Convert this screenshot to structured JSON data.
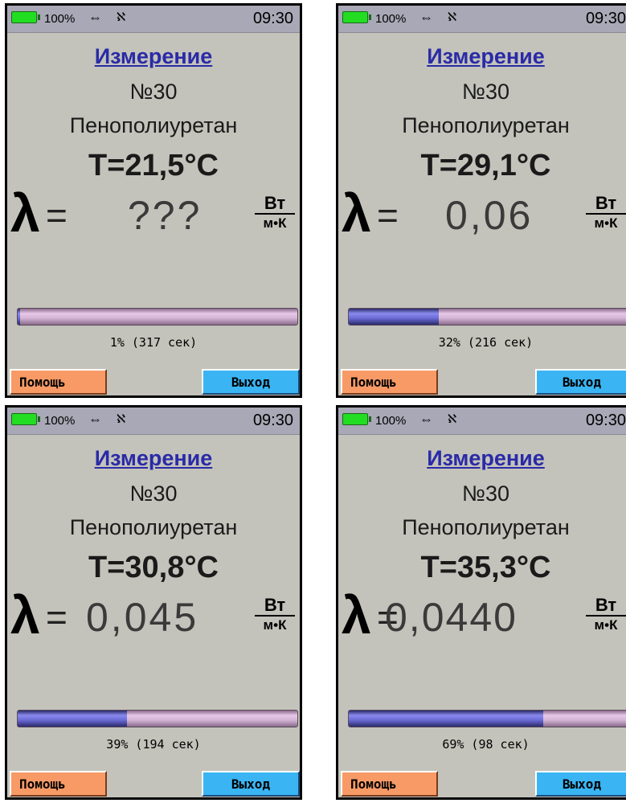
{
  "screens": [
    {
      "status": {
        "battery": "100%",
        "usb_icon": "⇔",
        "bt_icon": "ℵ",
        "time": "09:30"
      },
      "title": "Измерение",
      "number": "№30",
      "material": "Пенополиуретан",
      "temperature": "T=21,5°C",
      "lambda_symbol": "λ",
      "equals": "=",
      "lambda_value": "???",
      "unit_numerator": "Вт",
      "unit_denominator": "м•К",
      "progress_percent": 1,
      "progress_text": "1% (317 сек)",
      "help_label": "Помощь",
      "exit_label": "Выход"
    },
    {
      "status": {
        "battery": "100%",
        "usb_icon": "⇔",
        "bt_icon": "ℵ",
        "time": "09:30"
      },
      "title": "Измерение",
      "number": "№30",
      "material": "Пенополиуретан",
      "temperature": "T=29,1°C",
      "lambda_symbol": "λ",
      "equals": "=",
      "lambda_value": "0,06",
      "unit_numerator": "Вт",
      "unit_denominator": "м•К",
      "progress_percent": 32,
      "progress_text": "32% (216 сек)",
      "help_label": "Помощь",
      "exit_label": "Выход"
    },
    {
      "status": {
        "battery": "100%",
        "usb_icon": "⇔",
        "bt_icon": "ℵ",
        "time": "09:30"
      },
      "title": "Измерение",
      "number": "№30",
      "material": "Пенополиуретан",
      "temperature": "T=30,8°C",
      "lambda_symbol": "λ",
      "equals": "=",
      "lambda_value": "0,045",
      "unit_numerator": "Вт",
      "unit_denominator": "м•К",
      "progress_percent": 39,
      "progress_text": "39% (194 сек)",
      "help_label": "Помощь",
      "exit_label": "Выход"
    },
    {
      "status": {
        "battery": "100%",
        "usb_icon": "⇔",
        "bt_icon": "ℵ",
        "time": "09:30"
      },
      "title": "Измерение",
      "number": "№30",
      "material": "Пенополиуретан",
      "temperature": "T=35,3°C",
      "lambda_symbol": "λ",
      "equals": "=",
      "lambda_value": "0,0440",
      "unit_numerator": "Вт",
      "unit_denominator": "м•К",
      "progress_percent": 69,
      "progress_text": "69% (98 сек)",
      "help_label": "Помощь",
      "exit_label": "Выход"
    }
  ],
  "colors": {
    "screen_bg": "#c3c3bb",
    "status_bar": "#a8a8b6",
    "title": "#2a2aa8",
    "battery": "#22dd22",
    "help_button": "#f89a66",
    "exit_button": "#3ab4f2",
    "progress_fill": "#6a6ad4",
    "progress_track": "#d4b4d4"
  }
}
